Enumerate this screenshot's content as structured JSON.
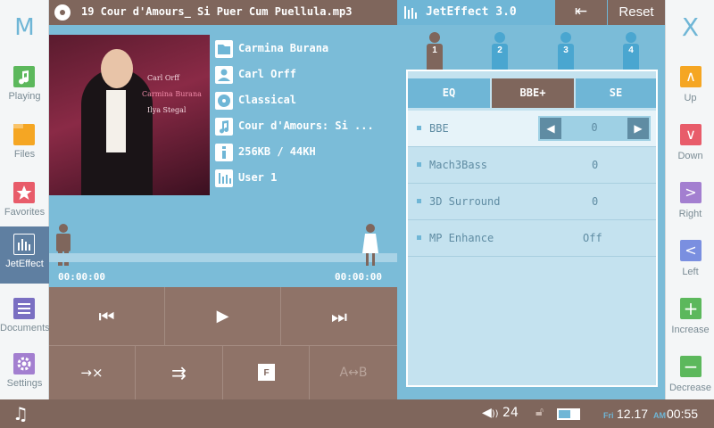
{
  "sidebar_left": {
    "logo": "M",
    "items": [
      {
        "label": "Playing",
        "icon": "music-note-icon",
        "color": "#5cb85c"
      },
      {
        "label": "Files",
        "icon": "folder-icon",
        "color": "#f5a623"
      },
      {
        "label": "Favorites",
        "icon": "star-icon",
        "color": "#e85c6a"
      },
      {
        "label": "JetEffect",
        "icon": "equalizer-icon",
        "color": "#5f7fa1",
        "active": true
      },
      {
        "label": "Documents",
        "icon": "document-icon",
        "color": "#7a6fc2"
      },
      {
        "label": "Settings",
        "icon": "gear-icon",
        "color": "#a37fd0"
      }
    ]
  },
  "sidebar_right": {
    "close": "X",
    "items": [
      {
        "label": "Up",
        "icon": "arrow-up-icon",
        "glyph": "∧",
        "color": "#f5a623"
      },
      {
        "label": "Down",
        "icon": "arrow-down-icon",
        "glyph": "∨",
        "color": "#e85c6a"
      },
      {
        "label": "Right",
        "icon": "arrow-right-icon",
        "glyph": ">",
        "color": "#a37fd0"
      },
      {
        "label": "Left",
        "icon": "arrow-left-icon",
        "glyph": "<",
        "color": "#7a8fe0"
      },
      {
        "label": "Increase",
        "icon": "plus-icon",
        "glyph": "+",
        "color": "#5cb85c"
      },
      {
        "label": "Decrease",
        "icon": "minus-icon",
        "glyph": "−",
        "color": "#5cb85c"
      }
    ]
  },
  "now_playing": {
    "file_name": "19 Cour d'Amours_ Si Puer Cum Puellula.mp3",
    "album_art_text": {
      "composer": "Carl Orff",
      "title": "Carmina Burana",
      "performer": "Ilya Stegal"
    },
    "album": "Carmina Burana",
    "artist": "Carl Orff",
    "genre": "Classical",
    "title": "Cour d'Amours: Si ...",
    "format": "256KB / 44KH",
    "eq_preset": "User 1",
    "elapsed": "00:00:00",
    "total": "00:00:00",
    "progress": 0.0
  },
  "controls": {
    "prev_icon": "⏮",
    "play_icon": "▶",
    "next_icon": "⏭",
    "repeat_label": "→×",
    "shuffle_label": "⇉",
    "folder_label": "F",
    "ab_label": "A↔B"
  },
  "jet_effect": {
    "title": "JetEffect 3.0",
    "back_icon": "⇤",
    "reset_label": "Reset",
    "presets": [
      "1",
      "2",
      "3",
      "4"
    ],
    "active_preset": 0,
    "tabs": [
      "EQ",
      "BBE+",
      "SE"
    ],
    "active_tab": 1,
    "settings": [
      {
        "label": "BBE",
        "value": "0"
      },
      {
        "label": "Mach3Bass",
        "value": "0"
      },
      {
        "label": "3D Surround",
        "value": "0"
      },
      {
        "label": "MP Enhance",
        "value": "Off"
      }
    ]
  },
  "status": {
    "volume": "24",
    "battery_level": 0.6,
    "day": "Fri",
    "date": "12.17",
    "ampm": "AM",
    "time": "00:55"
  },
  "colors": {
    "accent_blue": "#6fb6d6",
    "brown": "#7f665c",
    "panel_blue": "#7bbcd8"
  }
}
